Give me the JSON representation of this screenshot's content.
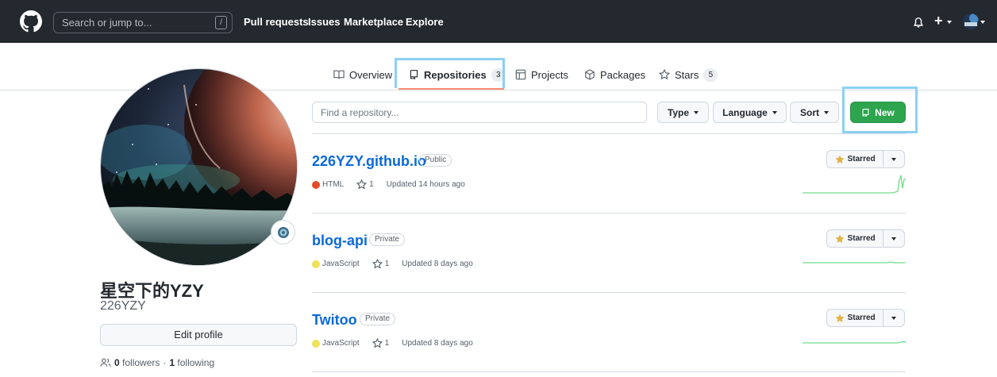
{
  "header": {
    "search_placeholder": "Search or jump to...",
    "search_shortcut": "/",
    "nav": [
      "Pull requests",
      "Issues",
      "Marketplace",
      "Explore"
    ],
    "add_label": "+"
  },
  "tabs": [
    {
      "label": "Overview",
      "icon": "book-icon"
    },
    {
      "label": "Repositories",
      "icon": "repo-icon",
      "count": "3",
      "active": true
    },
    {
      "label": "Projects",
      "icon": "table-icon"
    },
    {
      "label": "Packages",
      "icon": "package-icon"
    },
    {
      "label": "Stars",
      "icon": "star-icon",
      "count": "5"
    }
  ],
  "profile": {
    "display_name": "星空下的YZY",
    "username": "226YZY",
    "edit_label": "Edit profile",
    "followers": "0",
    "followers_label": "followers",
    "separator": "·",
    "following": "1",
    "following_label": "following"
  },
  "filter": {
    "placeholder": "Find a repository...",
    "type_label": "Type",
    "language_label": "Language",
    "sort_label": "Sort",
    "new_label": "New"
  },
  "repos": [
    {
      "name": "226YZY.github.io",
      "visibility": "Public",
      "language": "HTML",
      "lang_color": "#e34c26",
      "stars": "1",
      "updated": "Updated 14 hours ago",
      "star_label": "Starred"
    },
    {
      "name": "blog-api",
      "visibility": "Private",
      "language": "JavaScript",
      "lang_color": "#f1e05a",
      "stars": "1",
      "updated": "Updated 8 days ago",
      "star_label": "Starred"
    },
    {
      "name": "Twitoo",
      "visibility": "Private",
      "language": "JavaScript",
      "lang_color": "#f1e05a",
      "stars": "1",
      "updated": "Updated 8 days ago",
      "star_label": "Starred"
    }
  ],
  "colors": {
    "header_bg": "#24292f",
    "link": "#0969da",
    "primary_button": "#2da44e",
    "spark": "#6fdd8b",
    "annotation": "#8dd0f3"
  }
}
